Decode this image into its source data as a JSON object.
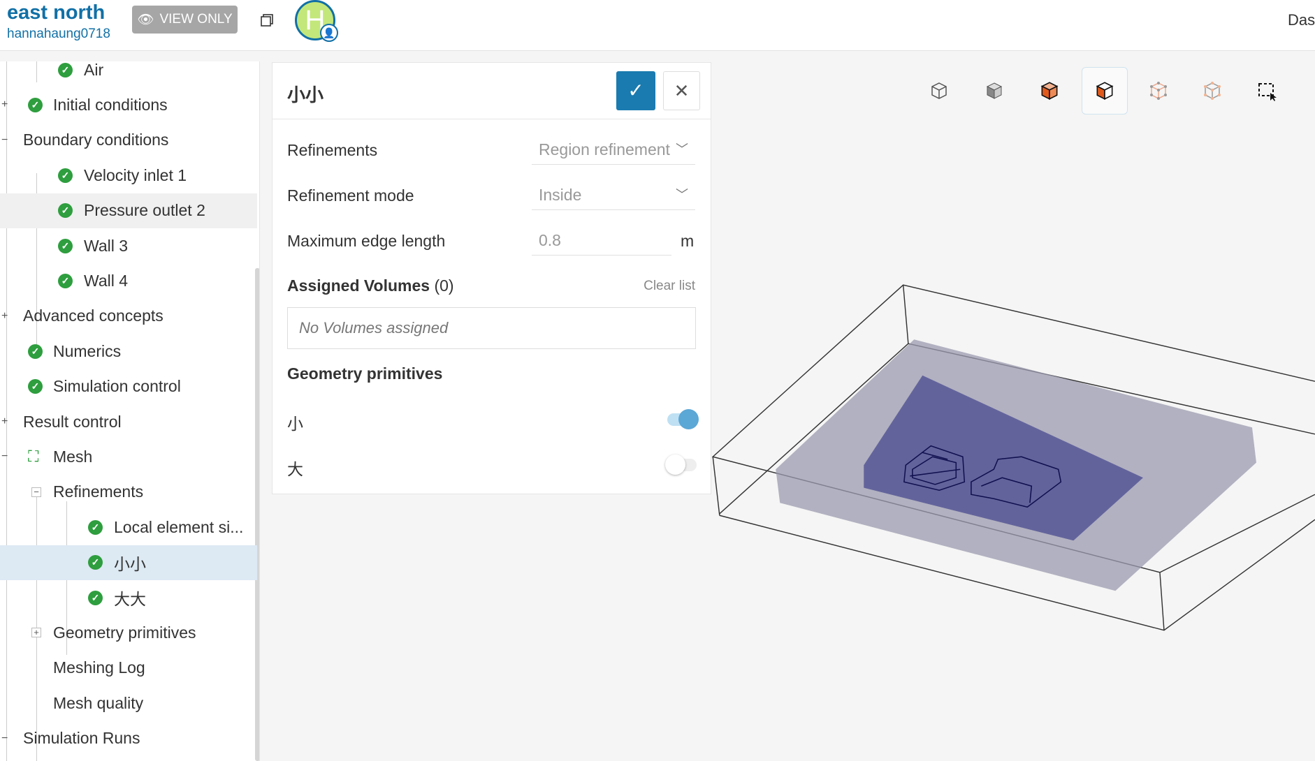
{
  "header": {
    "project_title": "east north",
    "username": "hannahaung0718",
    "view_only_label": "VIEW ONLY",
    "avatar_initial": "H",
    "right_text": "Das"
  },
  "tree": [
    {
      "label": "Air",
      "level": 2,
      "check": true
    },
    {
      "label": "Initial conditions",
      "level": 1,
      "check": true,
      "expander": "+"
    },
    {
      "label": "Boundary conditions",
      "level": 0,
      "expander": "−"
    },
    {
      "label": "Velocity inlet 1",
      "level": 2,
      "check": true
    },
    {
      "label": "Pressure outlet 2",
      "level": 2,
      "check": true,
      "state": "hover"
    },
    {
      "label": "Wall 3",
      "level": 2,
      "check": true
    },
    {
      "label": "Wall 4",
      "level": 2,
      "check": true
    },
    {
      "label": "Advanced concepts",
      "level": 0,
      "expander": "+"
    },
    {
      "label": "Numerics",
      "level": 1,
      "check": true
    },
    {
      "label": "Simulation control",
      "level": 1,
      "check": true
    },
    {
      "label": "Result control",
      "level": 0,
      "expander": "+"
    },
    {
      "label": "Mesh",
      "level": 1,
      "mesh_icon": true,
      "expander": "−"
    },
    {
      "label": "Refinements",
      "level": 1,
      "expander_inner": "−"
    },
    {
      "label": "Local element si...",
      "level": 3,
      "check": true
    },
    {
      "label": "小小",
      "level": 3,
      "check": true,
      "state": "selected"
    },
    {
      "label": "大大",
      "level": 3,
      "check": true
    },
    {
      "label": "Geometry primitives",
      "level": 1,
      "expander_inner": "+"
    },
    {
      "label": "Meshing Log",
      "level": 1
    },
    {
      "label": "Mesh quality",
      "level": 1
    },
    {
      "label": "Simulation Runs",
      "level": 0,
      "expander": "−"
    }
  ],
  "panel": {
    "title": "小小",
    "refinements_label": "Refinements",
    "refinements_value": "Region refinement",
    "mode_label": "Refinement mode",
    "mode_value": "Inside",
    "max_edge_label": "Maximum edge length",
    "max_edge_value": "0.8",
    "max_edge_unit": "m",
    "assigned_label": "Assigned Volumes",
    "assigned_count": "(0)",
    "clear_list": "Clear list",
    "no_volumes": "No Volumes assigned",
    "geom_label": "Geometry primitives",
    "primitives": [
      {
        "label": "小",
        "on": true
      },
      {
        "label": "大",
        "on": false
      }
    ]
  },
  "colors": {
    "accent": "#1a7bb0",
    "check": "#2e9e3e",
    "selected_row": "#dde9f3",
    "toggle_on": "#5ba7d6"
  }
}
